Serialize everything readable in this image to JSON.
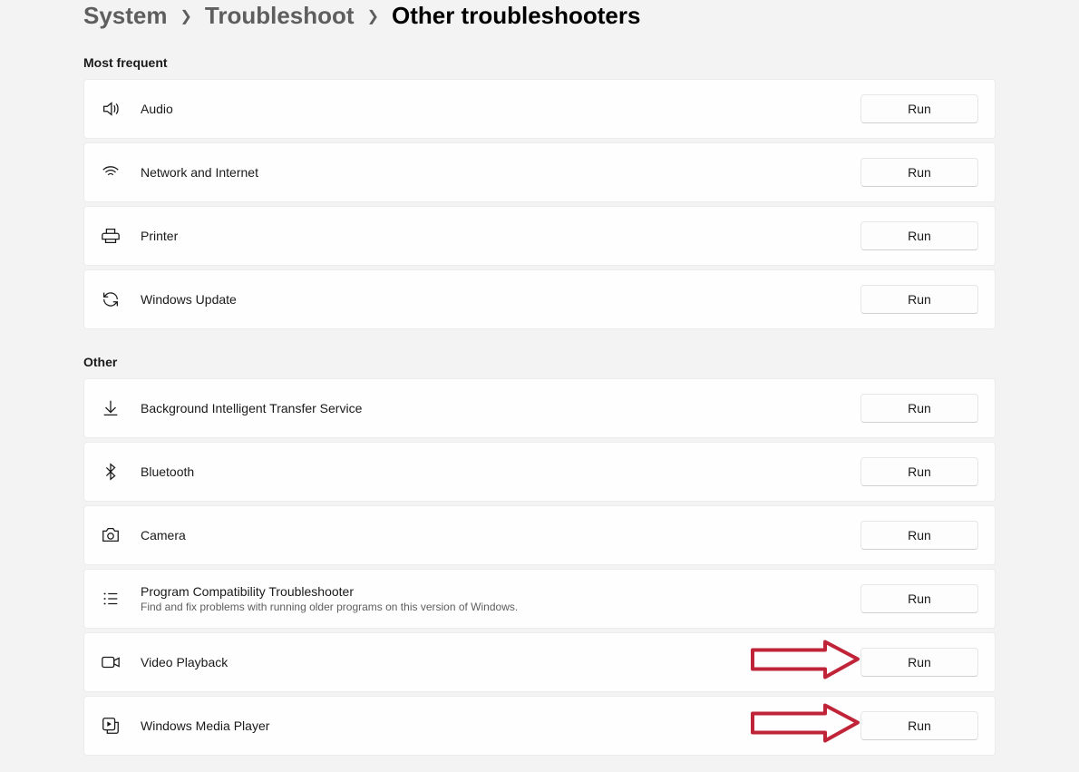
{
  "breadcrumb": {
    "items": [
      "System",
      "Troubleshoot",
      "Other troubleshooters"
    ]
  },
  "sections": {
    "most_frequent": {
      "header": "Most frequent",
      "items": [
        {
          "icon": "speaker-icon",
          "label": "Audio",
          "button": "Run"
        },
        {
          "icon": "wifi-icon",
          "label": "Network and Internet",
          "button": "Run"
        },
        {
          "icon": "printer-icon",
          "label": "Printer",
          "button": "Run"
        },
        {
          "icon": "sync-icon",
          "label": "Windows Update",
          "button": "Run"
        }
      ]
    },
    "other": {
      "header": "Other",
      "items": [
        {
          "icon": "download-icon",
          "label": "Background Intelligent Transfer Service",
          "button": "Run"
        },
        {
          "icon": "bluetooth-icon",
          "label": "Bluetooth",
          "button": "Run"
        },
        {
          "icon": "camera-icon",
          "label": "Camera",
          "button": "Run"
        },
        {
          "icon": "list-icon",
          "label": "Program Compatibility Troubleshooter",
          "subtitle": "Find and fix problems with running older programs on this version of Windows.",
          "button": "Run"
        },
        {
          "icon": "video-icon",
          "label": "Video Playback",
          "button": "Run",
          "annotated": true
        },
        {
          "icon": "media-player-icon",
          "label": "Windows Media Player",
          "button": "Run",
          "annotated": true
        }
      ]
    }
  },
  "annotation": {
    "arrow_color": "#c02438"
  }
}
